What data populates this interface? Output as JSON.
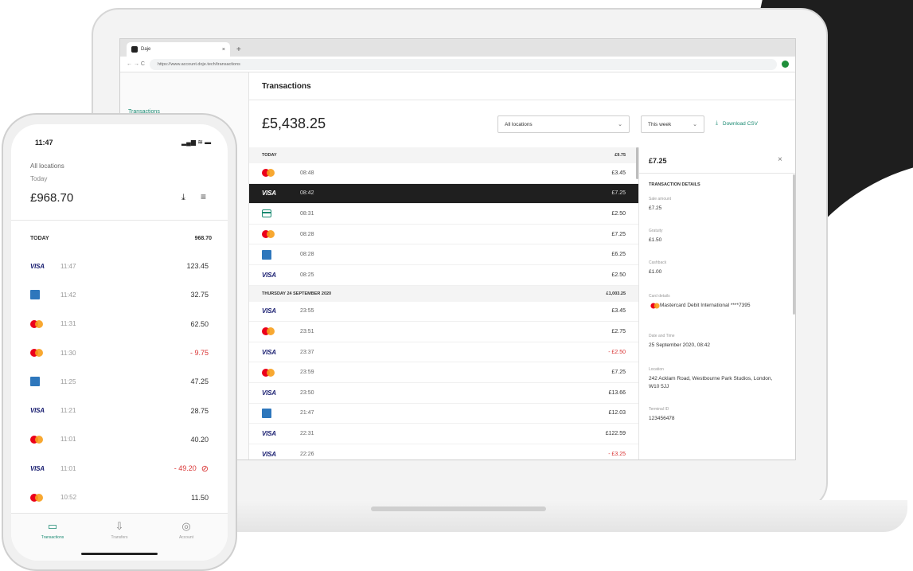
{
  "browser": {
    "tab_title": "Daje",
    "tab_close": "×",
    "new_tab": "+",
    "nav_glyphs": "← → C",
    "url": "https://www.account.doje.tech/transactions"
  },
  "desktop": {
    "sidebar_item": "Transactions",
    "page_title": "Transactions",
    "total": "£5,438.25",
    "location_select": "All locations",
    "period_select": "This week",
    "download_label": "Download CSV",
    "groups": [
      {
        "label": "TODAY",
        "total": "£9.75",
        "rows": [
          {
            "brand": "mastercard",
            "time": "08:48",
            "amount": "£3.45",
            "negative": false,
            "selected": false
          },
          {
            "brand": "visa",
            "time": "08:42",
            "amount": "£7.25",
            "negative": false,
            "selected": true
          },
          {
            "brand": "card",
            "time": "08:31",
            "amount": "£2.50",
            "negative": false,
            "selected": false
          },
          {
            "brand": "mastercard",
            "time": "08:28",
            "amount": "£7.25",
            "negative": false,
            "selected": false
          },
          {
            "brand": "amex",
            "time": "08:28",
            "amount": "£6.25",
            "negative": false,
            "selected": false
          },
          {
            "brand": "visa",
            "time": "08:25",
            "amount": "£2.50",
            "negative": false,
            "selected": false
          }
        ]
      },
      {
        "label": "THURSDAY 24 SEPTEMBER 2020",
        "total": "£1,003.25",
        "rows": [
          {
            "brand": "visa",
            "time": "23:55",
            "amount": "£3.45",
            "negative": false,
            "selected": false
          },
          {
            "brand": "mastercard",
            "time": "23:51",
            "amount": "£2.75",
            "negative": false,
            "selected": false
          },
          {
            "brand": "visa",
            "time": "23:37",
            "amount": "- £2.50",
            "negative": true,
            "selected": false
          },
          {
            "brand": "mastercard",
            "time": "23:59",
            "amount": "£7.25",
            "negative": false,
            "selected": false
          },
          {
            "brand": "visa",
            "time": "23:50",
            "amount": "£13.66",
            "negative": false,
            "selected": false
          },
          {
            "brand": "amex",
            "time": "21:47",
            "amount": "£12.03",
            "negative": false,
            "selected": false
          },
          {
            "brand": "visa",
            "time": "22:31",
            "amount": "£122.59",
            "negative": false,
            "selected": false
          },
          {
            "brand": "visa",
            "time": "22:26",
            "amount": "- £3.25",
            "negative": true,
            "selected": false
          }
        ]
      }
    ],
    "detail": {
      "amount": "£7.25",
      "close": "×",
      "heading": "TRANSACTION DETAILS",
      "fields": [
        {
          "label": "Sale amount",
          "value": "£7.25"
        },
        {
          "label": "Gratuity",
          "value": "£1.50"
        },
        {
          "label": "Cashback",
          "value": "£1.00"
        },
        {
          "label": "Card details",
          "value": "Mastercard Debit International ****7395"
        },
        {
          "label": "Date and Time",
          "value": "25 September 2020, 08:42"
        },
        {
          "label": "Location",
          "value": "242 Acklam Road, Westbourne Park Studios, London, W10 5JJ"
        },
        {
          "label": "Terminal ID",
          "value": "123456478"
        }
      ]
    }
  },
  "phone": {
    "time": "11:47",
    "status_icons": "▂▄▆ ≋ ▬",
    "location": "All locations",
    "day": "Today",
    "total": "£968.70",
    "group_label": "TODAY",
    "group_total": "968.70",
    "rows": [
      {
        "brand": "visa",
        "time": "11:47",
        "amount": "123.45",
        "negative": false,
        "refunded": false
      },
      {
        "brand": "amex",
        "time": "11:42",
        "amount": "32.75",
        "negative": false,
        "refunded": false
      },
      {
        "brand": "mastercard",
        "time": "11:31",
        "amount": "62.50",
        "negative": false,
        "refunded": false
      },
      {
        "brand": "mastercard",
        "time": "11:30",
        "amount": "- 9.75",
        "negative": true,
        "refunded": false
      },
      {
        "brand": "amex",
        "time": "11:25",
        "amount": "47.25",
        "negative": false,
        "refunded": false
      },
      {
        "brand": "visa",
        "time": "11:21",
        "amount": "28.75",
        "negative": false,
        "refunded": false
      },
      {
        "brand": "mastercard",
        "time": "11:01",
        "amount": "40.20",
        "negative": false,
        "refunded": false
      },
      {
        "brand": "visa",
        "time": "11:01",
        "amount": "- 49.20",
        "negative": true,
        "refunded": true
      },
      {
        "brand": "mastercard",
        "time": "10:52",
        "amount": "11.50",
        "negative": false,
        "refunded": false
      }
    ],
    "nav": [
      {
        "label": "Transactions",
        "icon": "card-icon",
        "glyph": "▭",
        "active": true
      },
      {
        "label": "Transfers",
        "icon": "download-icon",
        "glyph": "⇩",
        "active": false
      },
      {
        "label": "Account",
        "icon": "account-icon",
        "glyph": "◎",
        "active": false
      }
    ]
  },
  "colors": {
    "accent": "#1a8a72",
    "negative": "#d93434",
    "selected_row": "#1f1f1f"
  }
}
